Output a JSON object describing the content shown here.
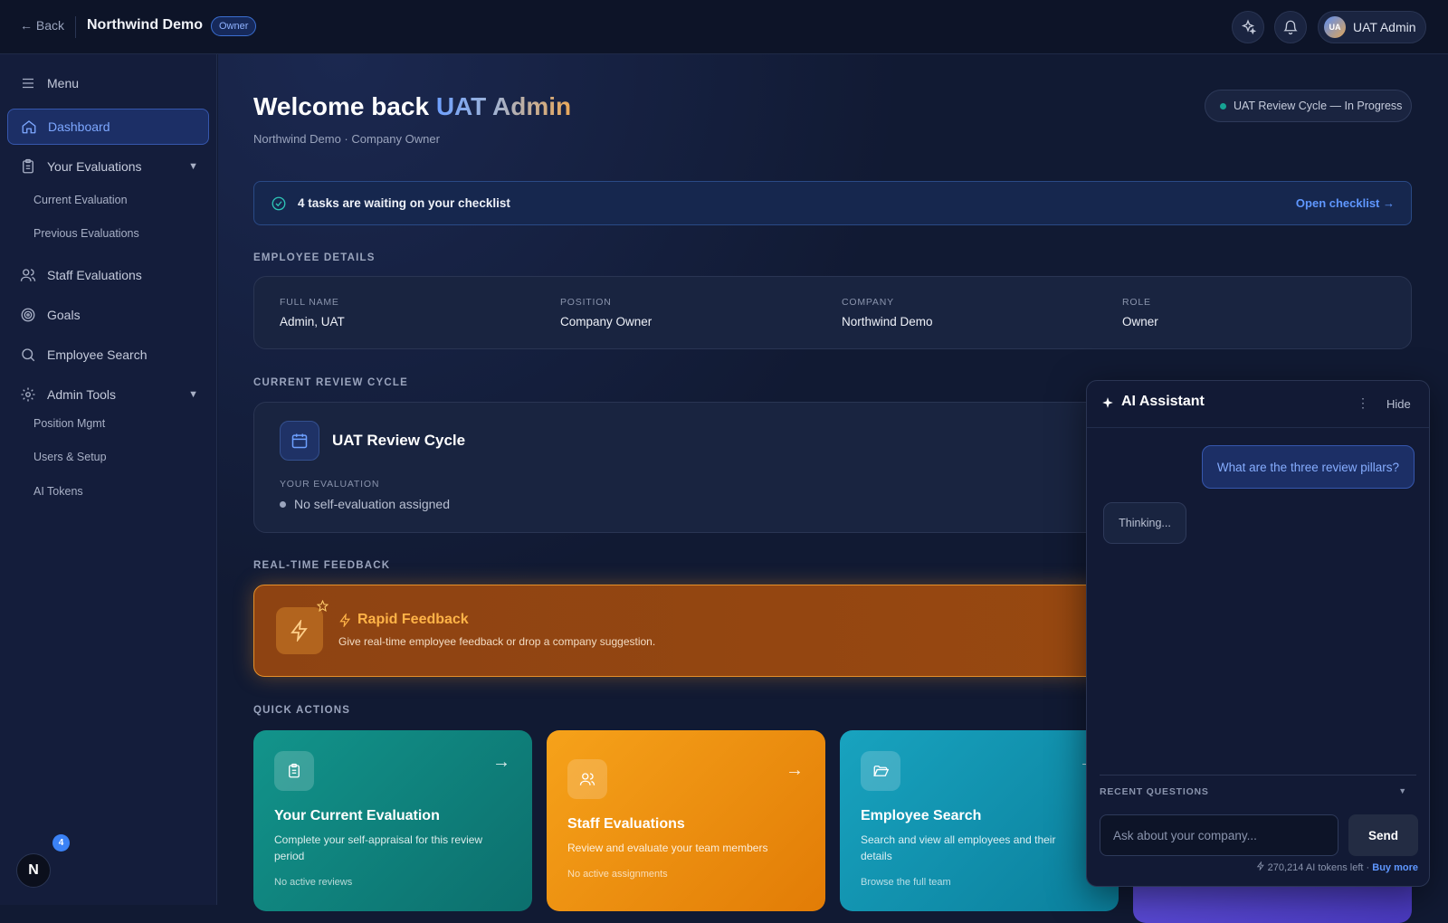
{
  "topbar": {
    "back_label": "← Back",
    "title": "Northwind Demo",
    "role_badge": "Owner",
    "user_initials": "UA",
    "user_name": "UAT Admin"
  },
  "sidebar": {
    "menu_label": "Menu",
    "items": [
      {
        "label": "Dashboard"
      },
      {
        "label": "Your Evaluations",
        "caret": "▼"
      },
      {
        "label": "Staff Evaluations"
      },
      {
        "label": "Goals"
      },
      {
        "label": "Employee Search"
      },
      {
        "label": "Admin Tools",
        "caret": "▼"
      }
    ],
    "your_evaluations_sub": [
      "Current Evaluation",
      "Previous Evaluations"
    ],
    "admin_tools_sub": [
      "Position Mgmt",
      "Users & Setup",
      "AI Tokens"
    ],
    "fab_letter": "N",
    "fab_badge": "4"
  },
  "header": {
    "welcome": "Welcome back",
    "welcome_name": "UAT Admin",
    "subline": "Northwind Demo · Company Owner",
    "cycle_status": "UAT Review Cycle — In Progress"
  },
  "checklist": {
    "text": "4 tasks are waiting on your checklist",
    "link": "Open checklist →"
  },
  "employee_details": {
    "heading": "EMPLOYEE DETAILS",
    "fields": [
      {
        "label": "FULL NAME",
        "value": "Admin, UAT"
      },
      {
        "label": "POSITION",
        "value": "Company Owner"
      },
      {
        "label": "COMPANY",
        "value": "Northwind Demo"
      },
      {
        "label": "ROLE",
        "value": "Owner"
      }
    ]
  },
  "review_cycle": {
    "heading": "CURRENT REVIEW CYCLE",
    "title": "UAT Review Cycle",
    "eval_label": "YOUR EVALUATION",
    "eval_status": "No self-evaluation assigned"
  },
  "feedback": {
    "heading": "REAL-TIME FEEDBACK",
    "title": "Rapid Feedback",
    "desc": "Give real-time employee feedback or drop a company suggestion."
  },
  "quick_actions": {
    "heading": "QUICK ACTIONS",
    "arrow": "→",
    "cards": [
      {
        "title": "Your Current Evaluation",
        "desc": "Complete your self-appraisal for this review period",
        "foot": "No active reviews",
        "color": "#0f8a82"
      },
      {
        "title": "Staff Evaluations",
        "desc": "Review and evaluate your team members",
        "foot": "No active assignments",
        "color": "#f0930f"
      },
      {
        "title": "Employee Search",
        "desc": "Search and view all employees and their details",
        "foot": "Browse the full team",
        "color": "#1297b3"
      }
    ]
  },
  "ai_panel": {
    "title": "AI Assistant",
    "more": "⋮",
    "hide": "Hide",
    "user_message": "What are the three review pillars?",
    "ai_message": "Thinking...",
    "recent_label": "RECENT QUESTIONS",
    "recent_chevron": "▼",
    "input_placeholder": "Ask about your company...",
    "send_label": "Send",
    "tokens_text": "270,214 AI tokens left ·",
    "buy_more": "Buy more"
  }
}
